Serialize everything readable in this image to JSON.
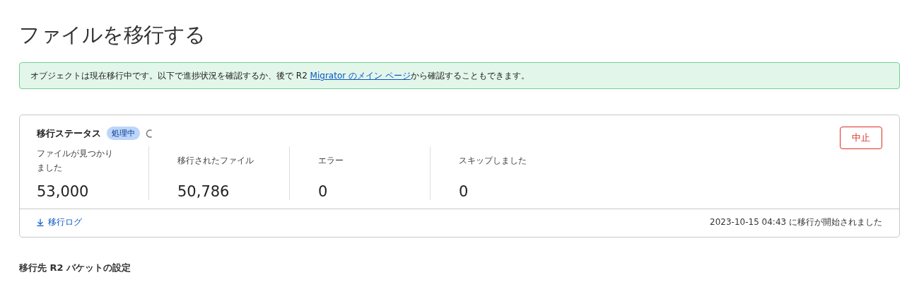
{
  "title": "ファイルを移行する",
  "notice": {
    "before": "オブジェクトは現在移行中です。以下で進捗状況を確認するか、後で R2 ",
    "link": "Migrator のメイン ページ",
    "after": "から確認することもできます。"
  },
  "status_card": {
    "title": "移行ステータス",
    "badge": "処理中",
    "loading": true,
    "abort_button": "中止",
    "stats": [
      {
        "label": "ファイルが見つかりました",
        "value": "53,000"
      },
      {
        "label": "移行されたファイル",
        "value": "50,786"
      },
      {
        "label": "エラー",
        "value": "0"
      },
      {
        "label": "スキップしました",
        "value": "0"
      }
    ],
    "log_link": "移行ログ",
    "started": "2023-10-15 04:43 に移行が開始されました"
  },
  "section_heading": "移行先 R2 バケットの設定"
}
